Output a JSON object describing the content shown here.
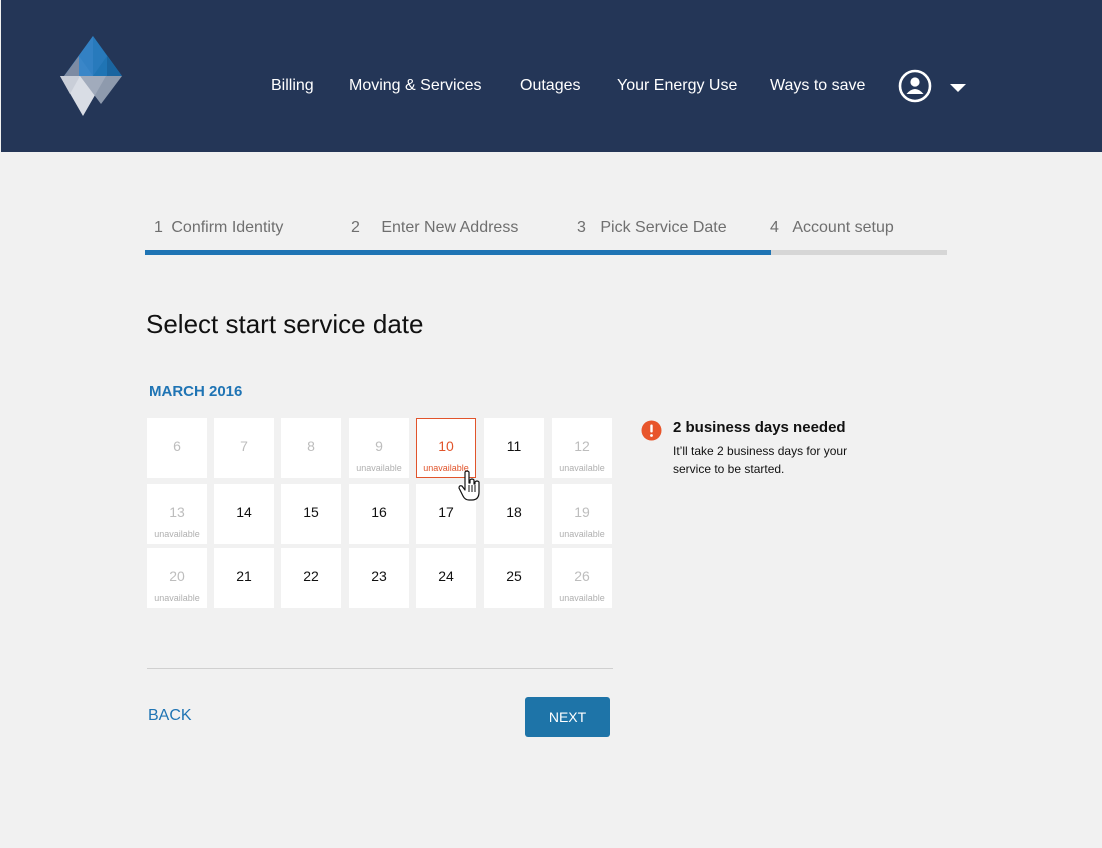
{
  "nav": {
    "items": [
      "Billing",
      "Moving & Services",
      "Outages",
      "Your Energy Use",
      "Ways to save"
    ]
  },
  "stepper": {
    "steps": [
      {
        "num": "1",
        "label": "Confirm Identity"
      },
      {
        "num": "2",
        "label": "Enter New Address"
      },
      {
        "num": "3",
        "label": "Pick Service Date"
      },
      {
        "num": "4",
        "label": "Account setup"
      }
    ],
    "progress_fraction": 0.78,
    "colors": {
      "fill": "#1f74b4",
      "track": "#d6d6d6"
    }
  },
  "page": {
    "title": "Select start service date",
    "month": "MARCH 2016"
  },
  "calendar": {
    "unavailable_label": "unavailable",
    "days": [
      {
        "day": "6",
        "available": false,
        "show_label": false
      },
      {
        "day": "7",
        "available": false,
        "show_label": false
      },
      {
        "day": "8",
        "available": false,
        "show_label": false
      },
      {
        "day": "9",
        "available": false,
        "show_label": true
      },
      {
        "day": "10",
        "available": false,
        "show_label": true,
        "selected": true
      },
      {
        "day": "11",
        "available": true
      },
      {
        "day": "12",
        "available": false,
        "show_label": true
      },
      {
        "day": "13",
        "available": false,
        "show_label": true
      },
      {
        "day": "14",
        "available": true
      },
      {
        "day": "15",
        "available": true
      },
      {
        "day": "16",
        "available": true
      },
      {
        "day": "17",
        "available": true
      },
      {
        "day": "18",
        "available": true
      },
      {
        "day": "19",
        "available": false,
        "show_label": true
      },
      {
        "day": "20",
        "available": false,
        "show_label": true
      },
      {
        "day": "21",
        "available": true
      },
      {
        "day": "22",
        "available": true
      },
      {
        "day": "23",
        "available": true
      },
      {
        "day": "24",
        "available": true
      },
      {
        "day": "25",
        "available": true
      },
      {
        "day": "26",
        "available": false,
        "show_label": true
      }
    ]
  },
  "notice": {
    "title": "2 business days needed",
    "body": "It’ll take 2 business days for your service to be started.",
    "icon": "alert-icon",
    "color": "#e8552b"
  },
  "actions": {
    "back_label": "BACK",
    "next_label": "NEXT"
  },
  "colors": {
    "header_bg": "#243657",
    "accent": "#1f74b4",
    "error": "#e1542b"
  }
}
